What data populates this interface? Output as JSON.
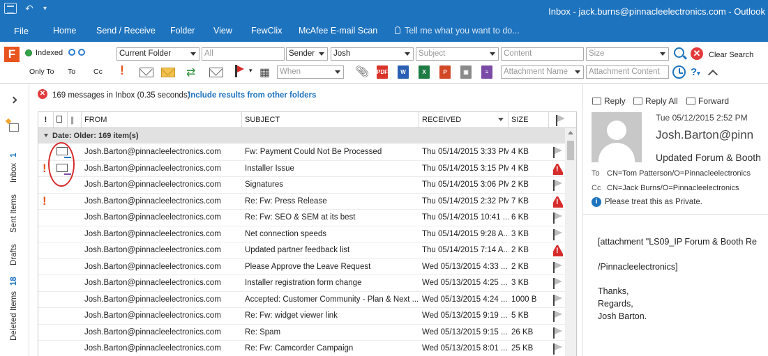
{
  "window": {
    "title": "Inbox - jack.burns@pinnacleelectronics.com - Outlook"
  },
  "ribbon": {
    "tabs": [
      "File",
      "Home",
      "Send / Receive",
      "Folder",
      "View",
      "FewClix",
      "McAfee E-mail Scan"
    ],
    "tell_me": "Tell me what you want to do..."
  },
  "toolbar": {
    "indexed": "Indexed",
    "scope": "Current Folder",
    "all_placeholder": "All",
    "sender_field": "Sender",
    "sender_value": "Josh",
    "subject_placeholder": "Subject",
    "content_placeholder": "Content",
    "size_placeholder": "Size",
    "clear_search": "Clear Search",
    "only_to": "Only To",
    "to": "To",
    "cc": "Cc",
    "when_placeholder": "When",
    "attachment_name_placeholder": "Attachment Name",
    "attachment_content_placeholder": "Attachment Content",
    "help": "?"
  },
  "nav": {
    "inbox": "Inbox",
    "inbox_count": "1",
    "sent": "Sent Items",
    "drafts": "Drafts",
    "deleted": "Deleted Items",
    "deleted_count": "18"
  },
  "status": {
    "text": "169 messages in Inbox (0.35 seconds)",
    "link": "Include results from other folders"
  },
  "list": {
    "columns": {
      "importance": "!",
      "from": "FROM",
      "subject": "SUBJECT",
      "received": "RECEIVED",
      "size": "SIZE"
    },
    "group": "Date: Older: 169 item(s)",
    "rows": [
      {
        "from": "Josh.Barton@pinnacleelectronics.com",
        "subject": "Fw: Payment Could Not Be Processed",
        "received": "Thu 05/14/2015 3:33 PM",
        "size": "4 KB",
        "important": "",
        "flag": "grey"
      },
      {
        "from": "Josh.Barton@pinnacleelectronics.com",
        "subject": "Installer Issue",
        "received": "Thu 05/14/2015 3:15 PM",
        "size": "4 KB",
        "important": "!",
        "flag": "warn"
      },
      {
        "from": "Josh.Barton@pinnacleelectronics.com",
        "subject": "Signatures",
        "received": "Thu 05/14/2015 3:06 PM",
        "size": "2 KB",
        "important": "",
        "flag": "grey"
      },
      {
        "from": "Josh.Barton@pinnacleelectronics.com",
        "subject": "Re: Fw: Press Release",
        "received": "Thu 05/14/2015 2:32 PM",
        "size": "7 KB",
        "important": "!",
        "flag": "warn"
      },
      {
        "from": "Josh.Barton@pinnacleelectronics.com",
        "subject": "Re: Fw: SEO & SEM at its best",
        "received": "Thu 05/14/2015 10:41 ...",
        "size": "6 KB",
        "important": "",
        "flag": "grey"
      },
      {
        "from": "Josh.Barton@pinnacleelectronics.com",
        "subject": "Net connection speeds",
        "received": "Thu 05/14/2015 9:28 A...",
        "size": "3 KB",
        "important": "",
        "flag": "grey"
      },
      {
        "from": "Josh.Barton@pinnacleelectronics.com",
        "subject": "Updated partner feedback list",
        "received": "Thu 05/14/2015 7:14 A...",
        "size": "2 KB",
        "important": "",
        "flag": "warn"
      },
      {
        "from": "Josh.Barton@pinnacleelectronics.com",
        "subject": "Please Approve the Leave Request",
        "received": "Wed 05/13/2015 4:33 ...",
        "size": "2 KB",
        "important": "",
        "flag": "grey"
      },
      {
        "from": "Josh.Barton@pinnacleelectronics.com",
        "subject": "Installer registration form change",
        "received": "Wed 05/13/2015 4:25 ...",
        "size": "3 KB",
        "important": "",
        "flag": "grey"
      },
      {
        "from": "Josh.Barton@pinnacleelectronics.com",
        "subject": "Accepted: Customer Community - Plan & Next ...",
        "received": "Wed 05/13/2015 4:24 ...",
        "size": "1000 B",
        "important": "",
        "flag": "grey"
      },
      {
        "from": "Josh.Barton@pinnacleelectronics.com",
        "subject": "Re: Fw: widget viewer link",
        "received": "Wed 05/13/2015 9:19 ...",
        "size": "5 KB",
        "important": "",
        "flag": "grey"
      },
      {
        "from": "Josh.Barton@pinnacleelectronics.com",
        "subject": "Re: Spam",
        "received": "Wed 05/13/2015 9:15 ...",
        "size": "26 KB",
        "important": "",
        "flag": "grey"
      },
      {
        "from": "Josh.Barton@pinnacleelectronics.com",
        "subject": "Re: Fw: Camcorder Campaign",
        "received": "Wed 05/13/2015 8:01 ...",
        "size": "25 KB",
        "important": "",
        "flag": "grey"
      }
    ]
  },
  "reading": {
    "reply": "Reply",
    "reply_all": "Reply All",
    "forward": "Forward",
    "date": "Tue 05/12/2015 2:52 PM",
    "sender": "Josh.Barton@pinn",
    "subject": "Updated Forum & Booth",
    "to_label": "To",
    "to_value": "CN=Tom Patterson/O=Pinnacleelectronics",
    "cc_label": "Cc",
    "cc_value": "CN=Jack Burns/O=Pinnacleelectronics",
    "info": "Please treat this as Private.",
    "body": [
      "[attachment \"LS09_IP Forum & Booth Re",
      "/Pinnacleelectronics]",
      "Thanks,",
      "Regards,",
      "Josh Barton."
    ]
  },
  "colors": {
    "brand_blue": "#1e73be",
    "alert_red": "#d62b2b",
    "importance_orange": "#e8531e"
  }
}
